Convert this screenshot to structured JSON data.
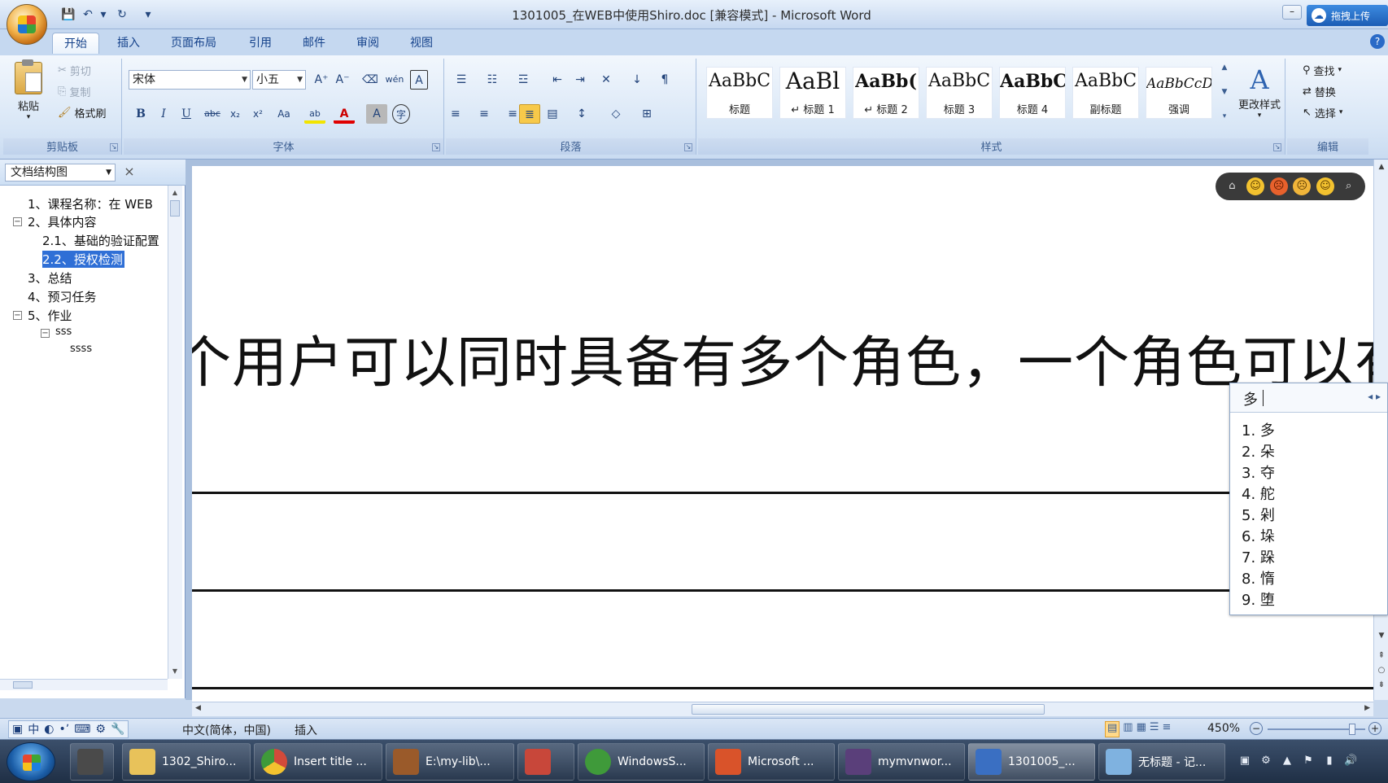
{
  "window": {
    "title": "1301005_在WEB中使用Shiro.doc [兼容模式] - Microsoft Word",
    "upload_label": "拖拽上传",
    "minimize_glyph": "–"
  },
  "qat": {
    "save": "💾",
    "undo": "↶",
    "redo": "↻",
    "more": "▾"
  },
  "tabs": [
    "开始",
    "插入",
    "页面布局",
    "引用",
    "邮件",
    "审阅",
    "视图"
  ],
  "help_glyph": "?",
  "ribbon": {
    "clipboard": {
      "label": "剪贴板",
      "paste": "粘贴",
      "cut": "剪切",
      "copy": "复制",
      "format_painter": "格式刷"
    },
    "font": {
      "label": "字体",
      "font_name": "宋体",
      "font_size": "小五",
      "grow": "A⁺",
      "shrink": "A⁻",
      "clear": "⌫",
      "phonetic": "wén",
      "border_char": "A",
      "bold": "B",
      "italic": "I",
      "underline": "U",
      "strike": "abc",
      "subscript": "x₂",
      "superscript": "x²",
      "case": "Aa",
      "highlight": "ab",
      "font_color": "A",
      "shading": "A",
      "enclose": "字"
    },
    "paragraph": {
      "label": "段落",
      "bullets": "☰",
      "numbering": "☷",
      "multilevel": "☲",
      "decrease_indent": "⇤",
      "increase_indent": "⇥",
      "chinese_layout": "✕",
      "sort": "↓",
      "show_marks": "¶",
      "align_left": "≡",
      "center": "≡",
      "align_right": "≡",
      "justify": "≣",
      "distributed": "▤",
      "line_spacing": "↕",
      "fill": "◇",
      "borders": "⊞"
    },
    "styles": {
      "label": "样式",
      "items": [
        {
          "sample": "AaBbC",
          "name": "标题"
        },
        {
          "sample": "AaBl",
          "name": "↵ 标题 1"
        },
        {
          "sample": "AaBb(",
          "name": "↵ 标题 2"
        },
        {
          "sample": "AaBbC",
          "name": "标题 3"
        },
        {
          "sample": "AaBbC",
          "name": "标题 4"
        },
        {
          "sample": "AaBbC",
          "name": "副标题"
        },
        {
          "sample": "AaBbCcDc",
          "name": "强调"
        }
      ],
      "change_styles": "更改样式"
    },
    "editing": {
      "label": "编辑",
      "find": "查找",
      "replace": "替换",
      "select": "选择"
    }
  },
  "doc_map": {
    "title": "文档结构图",
    "close": "×",
    "items": [
      {
        "text": "1、课程名称：在 WEB",
        "toggle": ""
      },
      {
        "text": "2、具体内容",
        "toggle": "−"
      },
      {
        "text": "2.1、基础的验证配置",
        "toggle": ""
      },
      {
        "text": "2.2、授权检测",
        "toggle": ""
      },
      {
        "text": "3、总结",
        "toggle": ""
      },
      {
        "text": "4、预习任务",
        "toggle": ""
      },
      {
        "text": "5、作业",
        "toggle": "−"
      },
      {
        "text": "sss",
        "toggle": "−"
      },
      {
        "text": "ssss",
        "toggle": ""
      }
    ]
  },
  "document": {
    "body_text": "个用户可以同时具备有多个角色，一个角色可以有"
  },
  "emoji_bar": [
    "⌂",
    "☺",
    "☹",
    "☹",
    "☺",
    "⌕"
  ],
  "ime": {
    "input": "多",
    "nav": "◂ ▸",
    "candidates": [
      "1. 多",
      "2. 朵",
      "3. 夺",
      "4. 舵",
      "5. 剁",
      "6. 垛",
      "7. 跺",
      "8. 惰",
      "9. 堕"
    ]
  },
  "status_bar": {
    "language": "中文(简体，中国)",
    "mode": "插入",
    "zoom": "450%",
    "ime_tools": [
      "中",
      "◐",
      "•ʼ",
      "⌨",
      "⚙",
      "🔧"
    ]
  },
  "taskbar": {
    "items": [
      {
        "label": "",
        "color": "#4a4a4a"
      },
      {
        "label": "1302_Shiro...",
        "color": "#e8c25a"
      },
      {
        "label": "Insert title ...",
        "color": "#d24a3a"
      },
      {
        "label": "E:\\my-lib\\...",
        "color": "#9a5a2a"
      },
      {
        "label": "",
        "color": "#c8473a"
      },
      {
        "label": "WindowsS...",
        "color": "#3f9a3a"
      },
      {
        "label": "Microsoft ...",
        "color": "#d9532a"
      },
      {
        "label": "mymvnwor...",
        "color": "#5a3f7a"
      },
      {
        "label": "1301005_...",
        "color": "#3a6fc2"
      },
      {
        "label": "无标题 - 记...",
        "color": "#7fb2e0"
      }
    ]
  }
}
